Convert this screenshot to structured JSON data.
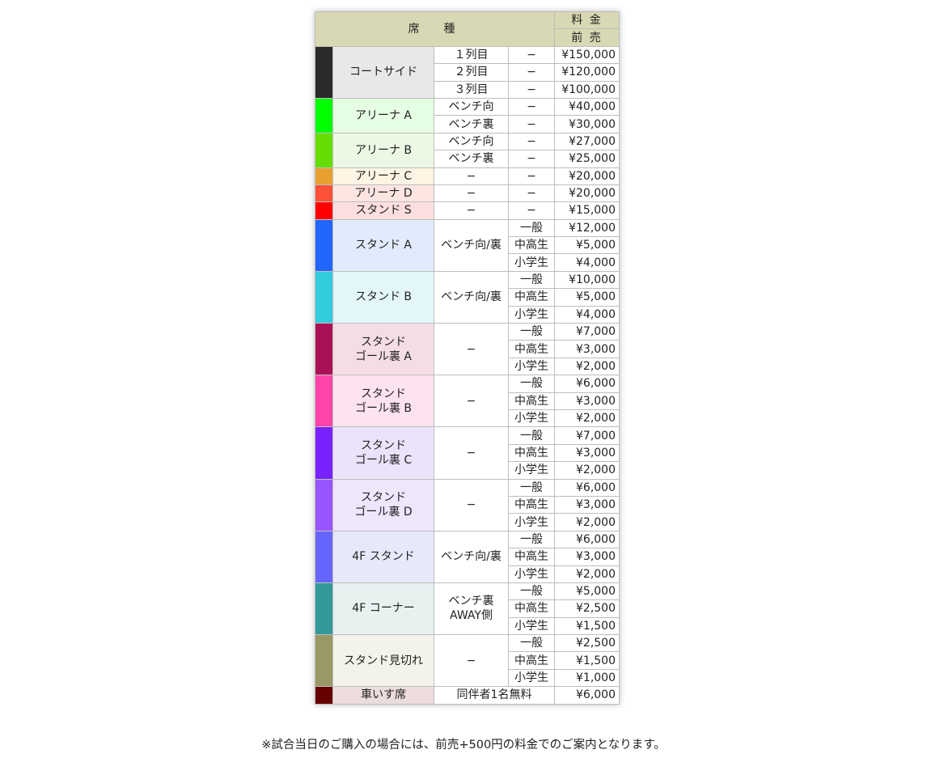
{
  "header": {
    "seat_label": "席　種",
    "fee_label": "料 金",
    "presale_label": "前 売"
  },
  "rows": [
    {
      "color": "#2a2a2a",
      "bg": "#e8e8e8",
      "name": [
        "コートサイド"
      ],
      "subs": [
        {
          "col3": "１列目",
          "col4": "−",
          "price": "¥150,000"
        },
        {
          "col3": "２列目",
          "col4": "−",
          "price": "¥120,000"
        },
        {
          "col3": "３列目",
          "col4": "−",
          "price": "¥100,000"
        }
      ]
    },
    {
      "color": "#00ff00",
      "bg": "#e5fde3",
      "name": [
        "アリーナ A"
      ],
      "subs": [
        {
          "col3": "ベンチ向",
          "col4": "−",
          "price": "¥40,000"
        },
        {
          "col3": "ベンチ裏",
          "col4": "−",
          "price": "¥30,000"
        }
      ]
    },
    {
      "color": "#66dd00",
      "bg": "#ecf8e4",
      "name": [
        "アリーナ B"
      ],
      "subs": [
        {
          "col3": "ベンチ向",
          "col4": "−",
          "price": "¥27,000"
        },
        {
          "col3": "ベンチ裏",
          "col4": "−",
          "price": "¥25,000"
        }
      ]
    },
    {
      "color": "#e8a030",
      "bg": "#fdf4e3",
      "name": [
        "アリーナ C"
      ],
      "subs": [
        {
          "col3": "−",
          "col4": "−",
          "price": "¥20,000"
        }
      ]
    },
    {
      "color": "#ff5038",
      "bg": "#fde6e2",
      "name": [
        "アリーナ D"
      ],
      "subs": [
        {
          "col3": "−",
          "col4": "−",
          "price": "¥20,000"
        }
      ]
    },
    {
      "color": "#ff0000",
      "bg": "#fddede",
      "name": [
        "スタンド S"
      ],
      "subs": [
        {
          "col3": "−",
          "col4": "−",
          "price": "¥15,000"
        }
      ]
    },
    {
      "color": "#2266ff",
      "bg": "#e2ebfb",
      "name": [
        "スタンド A"
      ],
      "mid": "ベンチ向/裏",
      "subs": [
        {
          "cat": "一般",
          "price": "¥12,000"
        },
        {
          "cat": "中高生",
          "price": "¥5,000"
        },
        {
          "cat": "小学生",
          "price": "¥4,000"
        }
      ]
    },
    {
      "color": "#33ccdd",
      "bg": "#e3f7fa",
      "name": [
        "スタンド B"
      ],
      "mid": "ベンチ向/裏",
      "subs": [
        {
          "cat": "一般",
          "price": "¥10,000"
        },
        {
          "cat": "中高生",
          "price": "¥5,000"
        },
        {
          "cat": "小学生",
          "price": "¥4,000"
        }
      ]
    },
    {
      "color": "#aa1155",
      "bg": "#f5dde6",
      "name": [
        "スタンド",
        "ゴール裏 A"
      ],
      "mid": "−",
      "subs": [
        {
          "cat": "一般",
          "price": "¥7,000"
        },
        {
          "cat": "中高生",
          "price": "¥3,000"
        },
        {
          "cat": "小学生",
          "price": "¥2,000"
        }
      ]
    },
    {
      "color": "#ff44aa",
      "bg": "#fde3f0",
      "name": [
        "スタンド",
        "ゴール裏 B"
      ],
      "mid": "−",
      "subs": [
        {
          "cat": "一般",
          "price": "¥6,000"
        },
        {
          "cat": "中高生",
          "price": "¥3,000"
        },
        {
          "cat": "小学生",
          "price": "¥2,000"
        }
      ]
    },
    {
      "color": "#7722ff",
      "bg": "#ece3fb",
      "name": [
        "スタンド",
        "ゴール裏 C"
      ],
      "mid": "−",
      "subs": [
        {
          "cat": "一般",
          "price": "¥7,000"
        },
        {
          "cat": "中高生",
          "price": "¥3,000"
        },
        {
          "cat": "小学生",
          "price": "¥2,000"
        }
      ]
    },
    {
      "color": "#9955ff",
      "bg": "#efe6fb",
      "name": [
        "スタンド",
        "ゴール裏 D"
      ],
      "mid": "−",
      "subs": [
        {
          "cat": "一般",
          "price": "¥6,000"
        },
        {
          "cat": "中高生",
          "price": "¥3,000"
        },
        {
          "cat": "小学生",
          "price": "¥2,000"
        }
      ]
    },
    {
      "color": "#6666ff",
      "bg": "#e8e8fb",
      "name": [
        "4F スタンド"
      ],
      "mid": "ベンチ向/裏",
      "subs": [
        {
          "cat": "一般",
          "price": "¥6,000"
        },
        {
          "cat": "中高生",
          "price": "¥3,000"
        },
        {
          "cat": "小学生",
          "price": "¥2,000"
        }
      ]
    },
    {
      "color": "#339999",
      "bg": "#e6f1f0",
      "name": [
        "4F コーナー"
      ],
      "mid": "ベンチ裏\nAWAY側",
      "subs": [
        {
          "cat": "一般",
          "price": "¥5,000"
        },
        {
          "cat": "中高生",
          "price": "¥2,500"
        },
        {
          "cat": "小学生",
          "price": "¥1,500"
        }
      ]
    },
    {
      "color": "#999966",
      "bg": "#f3f3ea",
      "name": [
        "スタンド見切れ"
      ],
      "mid": "−",
      "subs": [
        {
          "cat": "一般",
          "price": "¥2,500"
        },
        {
          "cat": "中高生",
          "price": "¥1,500"
        },
        {
          "cat": "小学生",
          "price": "¥1,000"
        }
      ]
    },
    {
      "color": "#660000",
      "bg": "#ecdcdc",
      "name": [
        "車いす席"
      ],
      "span_text": "同伴者1名無料",
      "subs": [
        {
          "price": "¥6,000"
        }
      ]
    }
  ],
  "note": "※試合当日のご購入の場合には、前売+500円の料金でのご案内となります。"
}
